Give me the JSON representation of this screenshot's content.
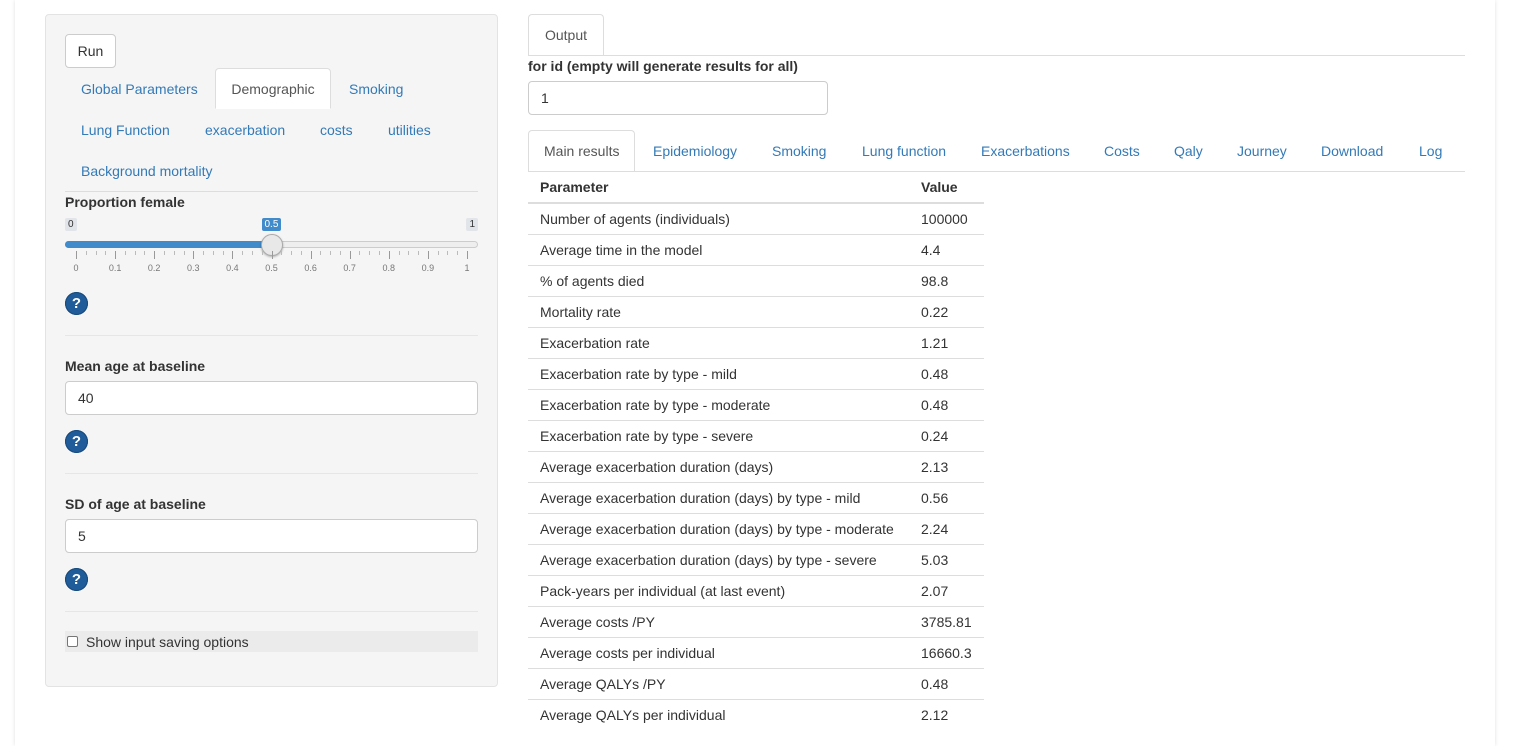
{
  "sidebar": {
    "run_label": "Run",
    "tabs": [
      {
        "label": "Global Parameters"
      },
      {
        "label": "Demographic"
      },
      {
        "label": "Smoking"
      },
      {
        "label": "Lung Function"
      },
      {
        "label": "exacerbation"
      },
      {
        "label": "costs"
      },
      {
        "label": "utilities"
      },
      {
        "label": "Background mortality"
      }
    ],
    "active_tab": "Demographic",
    "proportion_female": {
      "label": "Proportion female",
      "min_label": "0",
      "max_label": "1",
      "value_label": "0.5",
      "value": 0.5,
      "grid_labels": [
        "0",
        "0.1",
        "0.2",
        "0.3",
        "0.4",
        "0.5",
        "0.6",
        "0.7",
        "0.8",
        "0.9",
        "1"
      ]
    },
    "mean_age": {
      "label": "Mean age at baseline",
      "value": "40"
    },
    "sd_age": {
      "label": "SD of age at baseline",
      "value": "5"
    },
    "help_glyph": "?",
    "show_saving_label": "Show input saving options",
    "show_saving_checked": false
  },
  "main": {
    "output_tab": "Output",
    "id_label": "for id (empty will generate results for all)",
    "id_value": "1",
    "tabs": [
      {
        "label": "Main results"
      },
      {
        "label": "Epidemiology"
      },
      {
        "label": "Smoking"
      },
      {
        "label": "Lung function"
      },
      {
        "label": "Exacerbations"
      },
      {
        "label": "Costs"
      },
      {
        "label": "Qaly"
      },
      {
        "label": "Journey"
      },
      {
        "label": "Download"
      },
      {
        "label": "Log"
      }
    ],
    "active_tab": "Main results",
    "table": {
      "headers": [
        "Parameter",
        "Value"
      ],
      "rows": [
        [
          "Number of agents (individuals)",
          "100000"
        ],
        [
          "Average time in the model",
          "4.4"
        ],
        [
          "% of agents died",
          "98.8"
        ],
        [
          "Mortality rate",
          "0.22"
        ],
        [
          "Exacerbation rate",
          "1.21"
        ],
        [
          "Exacerbation rate by type - mild",
          "0.48"
        ],
        [
          "Exacerbation rate by type - moderate",
          "0.48"
        ],
        [
          "Exacerbation rate by type - severe",
          "0.24"
        ],
        [
          "Average exacerbation duration (days)",
          "2.13"
        ],
        [
          "Average exacerbation duration (days) by type - mild",
          "0.56"
        ],
        [
          "Average exacerbation duration (days) by type - moderate",
          "2.24"
        ],
        [
          "Average exacerbation duration (days) by type - severe",
          "5.03"
        ],
        [
          "Pack-years per individual (at last event)",
          "2.07"
        ],
        [
          "Average costs /PY",
          "3785.81"
        ],
        [
          "Average costs per individual",
          "16660.3"
        ],
        [
          "Average QALYs /PY",
          "0.48"
        ],
        [
          "Average QALYs per individual",
          "2.12"
        ]
      ]
    }
  },
  "colors": {
    "link": "#337ab7",
    "slider_fill": "#428bca",
    "help_icon": "#1f5c99"
  }
}
